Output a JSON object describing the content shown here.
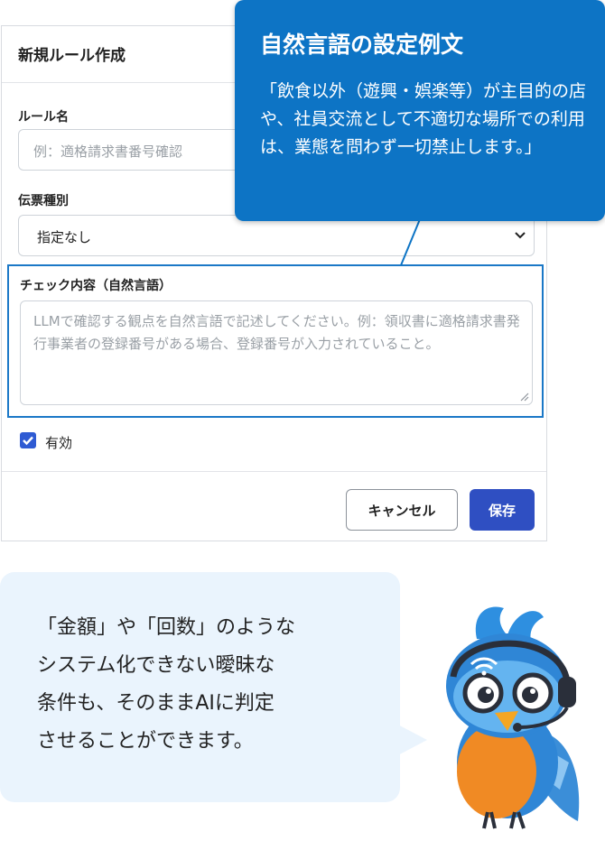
{
  "dialog": {
    "title": "新規ルール作成",
    "rule_name": {
      "label": "ルール名",
      "placeholder": "例：適格請求書番号確認"
    },
    "voucher_type": {
      "label": "伝票種別",
      "value": "指定なし"
    },
    "check": {
      "label": "チェック内容（自然言語）",
      "placeholder": "LLMで確認する観点を自然言語で記述してください。例：領収書に適格請求書発行事業者の登録番号がある場合、登録番号が入力されていること。"
    },
    "enabled": {
      "label": "有効",
      "checked": true
    },
    "buttons": {
      "cancel": "キャンセル",
      "save": "保存"
    }
  },
  "callout": {
    "title": "自然言語の設定例文",
    "body": "「飲食以外（遊興・娯楽等）が主目的の店や、社員交流として不適切な場所での利用は、業態を問わず一切禁止します。」"
  },
  "bubble": {
    "lines": [
      "「金額」や「回数」のような",
      "システム化できない曖昧な",
      "条件も、そのままAIに判定",
      "させることができます。"
    ]
  },
  "colors": {
    "accent": "#0d74c5",
    "save": "#2f4fc2",
    "bubble": "#eaf4fd",
    "highlight": "#1b78c7"
  },
  "icons": {
    "select": "chevron-down-icon",
    "checkbox": "check-icon",
    "mascot": "bird-mascot-with-headset"
  }
}
